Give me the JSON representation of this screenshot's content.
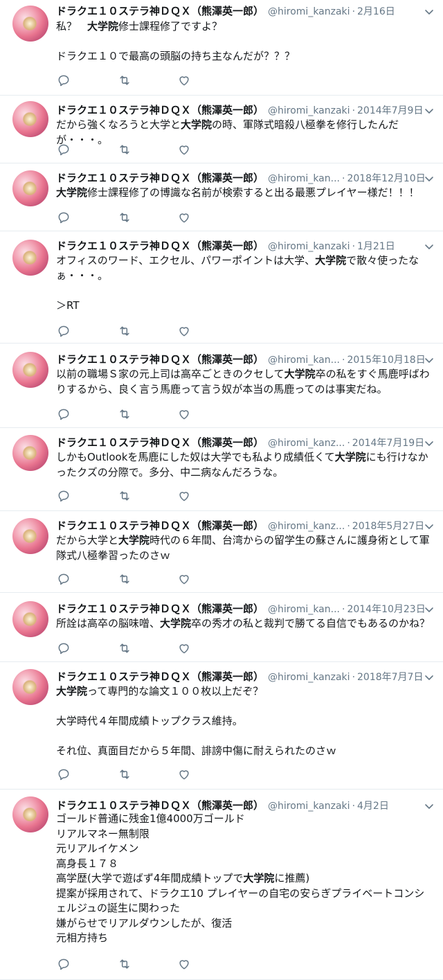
{
  "user": {
    "name": "ドラクエ１０ステラ神ＤＱＸ（熊澤英一郎）",
    "avatar_icon": "profile-avatar-icon"
  },
  "highlight_term": "大学院",
  "icons": {
    "reply": "reply-icon",
    "retweet": "retweet-icon",
    "like": "heart-icon",
    "menu": "chevron-down-icon"
  },
  "tweets": [
    {
      "handle": "@hiromi_kanzaki",
      "date": "2月16日",
      "segments": [
        {
          "t": "私？　"
        },
        {
          "t": "大学院",
          "b": true
        },
        {
          "t": "修士課程修了ですよ？\n\nドラクエ１０で最高の頭脳の持ち主なんだが？？？"
        }
      ]
    },
    {
      "handle": "@hiromi_kanzaki",
      "date": "2014年7月9日",
      "segments": [
        {
          "t": "だから強くなろうと大学と"
        },
        {
          "t": "大学院",
          "b": true
        },
        {
          "t": "の時、軍隊式暗殺八極拳を修行したんだが・・・。"
        }
      ]
    },
    {
      "handle": "@hiromi_kan...",
      "date": "2018年12月10日",
      "segments": [
        {
          "t": "大学院",
          "b": true
        },
        {
          "t": "修士課程修了の博識な名前が検索すると出る最悪プレイヤー様だ！！！"
        }
      ]
    },
    {
      "handle": "@hiromi_kanzaki",
      "date": "1月21日",
      "segments": [
        {
          "t": "オフィスのワード、エクセル、パワーポイントは大学、"
        },
        {
          "t": "大学院",
          "b": true
        },
        {
          "t": "で散々使ったなぁ・・・。\n\n＞RT"
        }
      ]
    },
    {
      "handle": "@hiromi_kan...",
      "date": "2015年10月18日",
      "segments": [
        {
          "t": "以前の職場Ｓ家の元上司は高卒ごときのクセして"
        },
        {
          "t": "大学院",
          "b": true
        },
        {
          "t": "卒の私をすぐ馬鹿呼ばわりするから、良く言う馬鹿って言う奴が本当の馬鹿ってのは事実だね。"
        }
      ]
    },
    {
      "handle": "@hiromi_kanz...",
      "date": "2014年7月19日",
      "segments": [
        {
          "t": "しかもOutlookを馬鹿にした奴は大学でも私より成績低くて"
        },
        {
          "t": "大学院",
          "b": true
        },
        {
          "t": "にも行けなかったクズの分際で。多分、中二病なんだろうな。"
        }
      ]
    },
    {
      "handle": "@hiromi_kanz...",
      "date": "2018年5月27日",
      "segments": [
        {
          "t": "だから大学と"
        },
        {
          "t": "大学院",
          "b": true
        },
        {
          "t": "時代の６年間、台湾からの留学生の蘇さんに護身術として軍隊式八極拳習ったのさｗ"
        }
      ]
    },
    {
      "handle": "@hiromi_kan...",
      "date": "2014年10月23日",
      "segments": [
        {
          "t": "所詮は高卒の脳味噌、"
        },
        {
          "t": "大学院",
          "b": true
        },
        {
          "t": "卒の秀才の私と裁判で勝てる自信でもあるのかね？"
        }
      ]
    },
    {
      "handle": "@hiromi_kanzaki",
      "date": "2018年7月7日",
      "segments": [
        {
          "t": "大学院",
          "b": true
        },
        {
          "t": "って専門的な論文１００枚以上だぞ？\n\n大学時代４年間成績トップクラス維持。\n\nそれ位、真面目だから５年間、誹謗中傷に耐えられたのさｗ"
        }
      ]
    },
    {
      "handle": "@hiromi_kanzaki",
      "date": "4月2日",
      "segments": [
        {
          "t": "ゴールド普通に残金1億4000万ゴールド\nリアルマネー無制限\n元リアルイケメン\n高身長１７８\n高学歴(大学で遊ばず4年間成績トップで"
        },
        {
          "t": "大学院",
          "b": true
        },
        {
          "t": "に推薦)\n提案が採用されて、ドラクエ10 プレイヤーの自宅の安らぎプライベートコンシェルジュの誕生に関わった\n嫌がらせでリアルダウンしたが、復活\n元相方持ち"
        }
      ]
    }
  ]
}
